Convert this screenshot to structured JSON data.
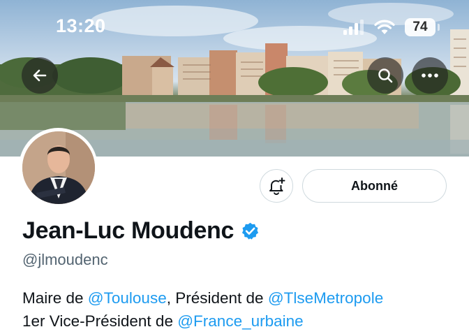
{
  "status_bar": {
    "time": "13:20",
    "battery": "74"
  },
  "header": {
    "back_icon": "arrow-left-icon",
    "search_icon": "search-icon",
    "more_icon": "more-horizontal-icon"
  },
  "profile": {
    "display_name": "Jean-Luc Moudenc",
    "handle": "@jlmoudenc",
    "verified_icon": "verified-badge-icon",
    "verified_color": "#1d9bf0",
    "notify_icon": "bell-plus-icon",
    "follow_label": "Abonné"
  },
  "bio": {
    "line1": {
      "t1": "Maire de ",
      "m1": "@Toulouse",
      "t2": ", Président de ",
      "m2": "@TlseMetropole"
    },
    "line2": {
      "t1": "1er Vice-Président de ",
      "m1": "@France_urbaine"
    }
  },
  "colors": {
    "link": "#1d9bf0",
    "text": "#0f1419",
    "muted": "#536471"
  }
}
